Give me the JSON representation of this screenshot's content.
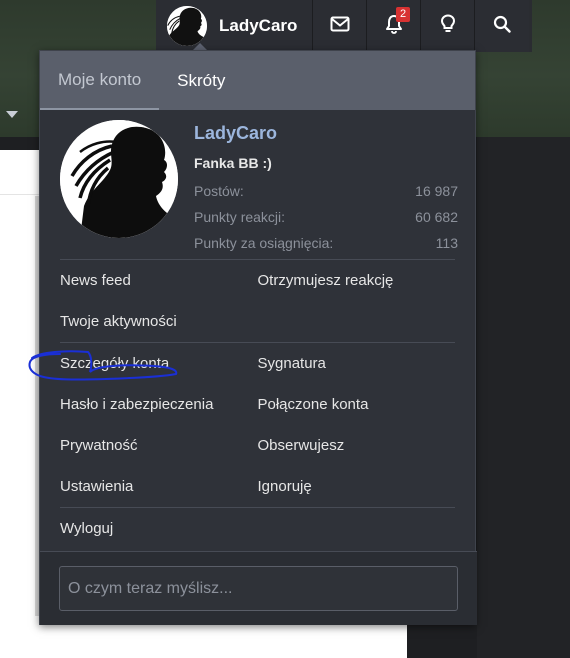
{
  "navbar": {
    "username": "LadyCaro",
    "notifications_count": "2",
    "icons": [
      "envelope-icon",
      "bell-icon",
      "lightbulb-icon",
      "search-icon"
    ]
  },
  "menu": {
    "tabs": [
      {
        "label": "Moje konto",
        "active": true
      },
      {
        "label": "Skróty",
        "active": false
      }
    ],
    "profile": {
      "name": "LadyCaro",
      "title": "Fanka BB :)",
      "stats": [
        {
          "label": "Postów:",
          "value": "16 987"
        },
        {
          "label": "Punkty reakcji:",
          "value": "60 682"
        },
        {
          "label": "Punkty za osiągnięcia:",
          "value": "113"
        }
      ]
    },
    "links": {
      "news_feed": "News feed",
      "reactions_received": "Otrzymujesz reakcję",
      "your_activity": "Twoje aktywności",
      "account_details": "Szczegóły konta",
      "signature": "Sygnatura",
      "password_security": "Hasło i zabezpieczenia",
      "connected_accounts": "Połączone konta",
      "privacy": "Prywatność",
      "following": "Obserwujesz",
      "settings": "Ustawienia",
      "ignoring": "Ignoruję",
      "logout": "Wyloguj"
    },
    "status_placeholder": "O czym teraz myślisz..."
  },
  "colors": {
    "accent_name": "#9cb6dd",
    "menu_bg": "#2f3239",
    "tab_bar": "#5a5f6b",
    "badge": "#d83232",
    "annotation": "#1a2fd6"
  }
}
